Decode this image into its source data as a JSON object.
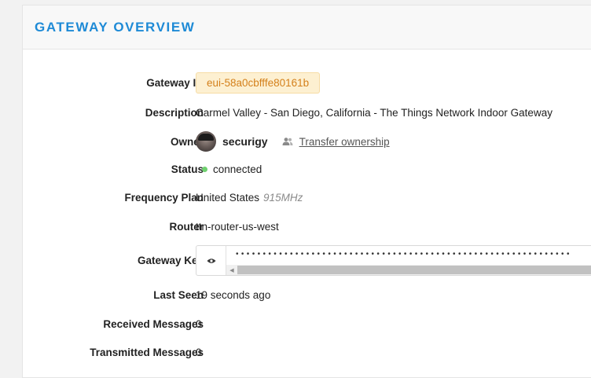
{
  "card": {
    "title": "GATEWAY OVERVIEW"
  },
  "rows": {
    "gateway_id": {
      "label": "Gateway ID",
      "value": "eui-58a0cbfffe80161b"
    },
    "description": {
      "label": "Description",
      "value": "Carmel Valley - San Diego, California - The Things Network Indoor Gateway"
    },
    "owner": {
      "label": "Owner",
      "name": "securigy",
      "transfer_label": "Transfer ownership",
      "avatar_icon": "user-avatar",
      "transfer_icon": "people-icon"
    },
    "status": {
      "label": "Status",
      "value": "connected",
      "dot_color": "#6fd16f"
    },
    "frequency_plan": {
      "label": "Frequency Plan",
      "region": "United States",
      "mhz": "915MHz"
    },
    "router": {
      "label": "Router",
      "value": "ttn-router-us-west"
    },
    "gateway_key": {
      "label": "Gateway Key",
      "masked": "••••••••••••••••••••••••••••••••••••••••••••••••••••••••••••••",
      "toggle_icon": "eye-icon"
    },
    "last_seen": {
      "label": "Last Seen",
      "value": "19 seconds ago"
    },
    "received": {
      "label": "Received Messages",
      "value": "0"
    },
    "transmitted": {
      "label": "Transmitted Messages",
      "value": "0"
    }
  },
  "colors": {
    "accent": "#1e8ad6",
    "badge_bg": "#fdf0d1",
    "badge_text": "#d4801b"
  }
}
